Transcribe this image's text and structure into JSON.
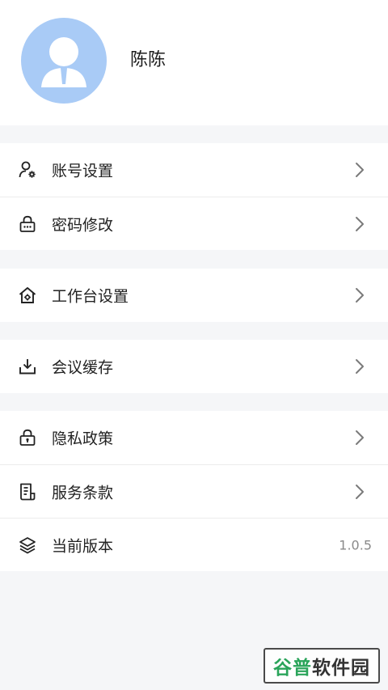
{
  "profile": {
    "username": "陈陈",
    "avatar_icon": "user-avatar-icon",
    "avatar_color": "#a9cbf6"
  },
  "menu": {
    "account_settings": {
      "label": "账号设置",
      "icon": "user-gear-icon"
    },
    "change_password": {
      "label": "密码修改",
      "icon": "lock-icon"
    },
    "workbench_settings": {
      "label": "工作台设置",
      "icon": "home-gear-icon"
    },
    "meeting_cache": {
      "label": "会议缓存",
      "icon": "download-icon"
    },
    "privacy_policy": {
      "label": "隐私政策",
      "icon": "lock-icon"
    },
    "terms_of_service": {
      "label": "服务条款",
      "icon": "document-icon"
    },
    "current_version": {
      "label": "当前版本",
      "icon": "layers-icon",
      "value": "1.0.5"
    }
  },
  "watermark": {
    "part1": "谷普",
    "part2": "软件园",
    "color_accent": "#2aa45a"
  }
}
